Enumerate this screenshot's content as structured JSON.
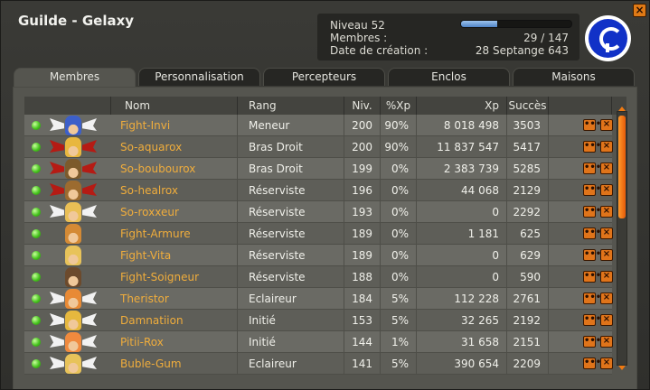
{
  "window": {
    "title": "Guilde - Gelaxy",
    "close_icon": "close-icon"
  },
  "info": {
    "level_label": "Niveau 52",
    "level_progress": 0.33,
    "members_label": "Membres :",
    "members_value": "29 / 147",
    "created_label": "Date de création :",
    "created_value": "28 Septange 643"
  },
  "tabs": [
    "Membres",
    "Personnalisation",
    "Percepteurs",
    "Enclos",
    "Maisons"
  ],
  "table": {
    "headers": [
      "Nom",
      "Rang",
      "Niv.",
      "%Xp",
      "Xp",
      "Succès"
    ],
    "rows": [
      {
        "name": "Fight-Invi",
        "rank": "Meneur",
        "level": "200",
        "xp_pct": "90%",
        "xp": "8 018 498",
        "success": "3503",
        "wing": "white",
        "headcolor": "#3c5fc9"
      },
      {
        "name": "So-aquarox",
        "rank": "Bras Droit",
        "level": "200",
        "xp_pct": "90%",
        "xp": "11 837 547",
        "success": "5417",
        "wing": "red",
        "headcolor": "#e8b73f"
      },
      {
        "name": "So-boubourox",
        "rank": "Bras Droit",
        "level": "199",
        "xp_pct": "0%",
        "xp": "2 383 739",
        "success": "5285",
        "wing": "red",
        "headcolor": "#7c5a2b"
      },
      {
        "name": "So-healrox",
        "rank": "Réserviste",
        "level": "196",
        "xp_pct": "0%",
        "xp": "44 068",
        "success": "2129",
        "wing": "red",
        "headcolor": "#9c6b2f"
      },
      {
        "name": "So-roxxeur",
        "rank": "Réserviste",
        "level": "193",
        "xp_pct": "0%",
        "xp": "0",
        "success": "2292",
        "wing": "white",
        "headcolor": "#e9bf55"
      },
      {
        "name": "Fight-Armure",
        "rank": "Réserviste",
        "level": "189",
        "xp_pct": "0%",
        "xp": "1 181",
        "success": "625",
        "wing": "none",
        "headcolor": "#d48a35"
      },
      {
        "name": "Fight-Vita",
        "rank": "Réserviste",
        "level": "189",
        "xp_pct": "0%",
        "xp": "0",
        "success": "629",
        "wing": "none",
        "headcolor": "#e8c35a"
      },
      {
        "name": "Fight-Soigneur",
        "rank": "Réserviste",
        "level": "188",
        "xp_pct": "0%",
        "xp": "0",
        "success": "590",
        "wing": "none",
        "headcolor": "#6c4a2c"
      },
      {
        "name": "Theristor",
        "rank": "Eclaireur",
        "level": "184",
        "xp_pct": "5%",
        "xp": "112 228",
        "success": "2761",
        "wing": "white",
        "headcolor": "#e88a35"
      },
      {
        "name": "Damnatiion",
        "rank": "Initié",
        "level": "153",
        "xp_pct": "5%",
        "xp": "32 265",
        "success": "2192",
        "wing": "white",
        "headcolor": "#e6b83e"
      },
      {
        "name": "Pitii-Rox",
        "rank": "Initié",
        "level": "144",
        "xp_pct": "1%",
        "xp": "31 658",
        "success": "2151",
        "wing": "white",
        "headcolor": "#f08a3e"
      },
      {
        "name": "Buble-Gum",
        "rank": "Eclaireur",
        "level": "141",
        "xp_pct": "5%",
        "xp": "390 654",
        "success": "2209",
        "wing": "white",
        "headcolor": "#e8c35a"
      }
    ]
  },
  "actions": {
    "more_label": "•••",
    "remove_label": "×"
  },
  "colors": {
    "accent": "#f0ad3c",
    "online": "#46c31e",
    "scroll": "#ff9a2c"
  }
}
